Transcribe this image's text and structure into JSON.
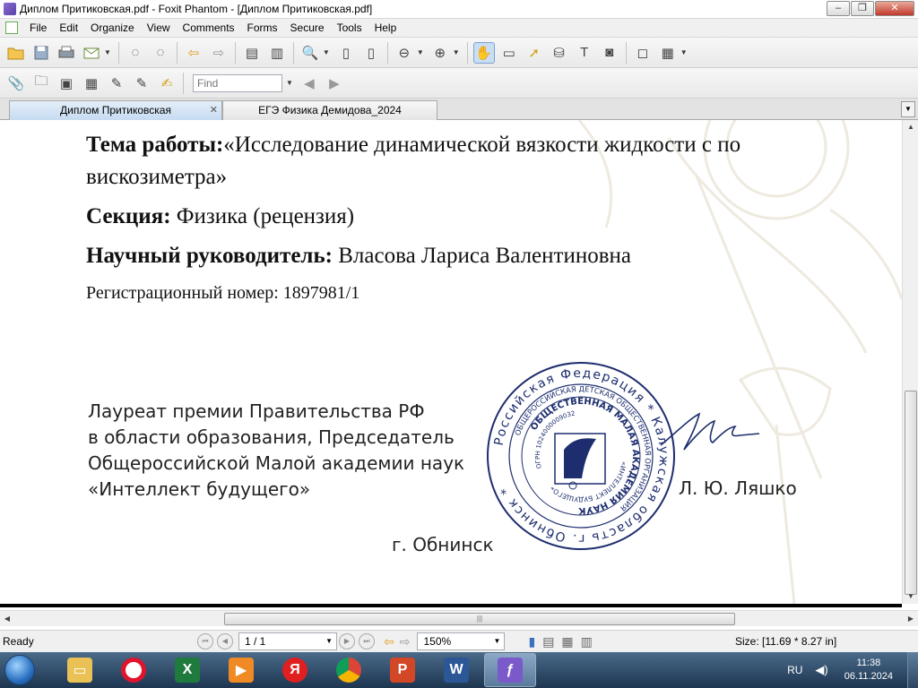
{
  "window": {
    "title": "Диплом Притиковская.pdf - Foxit Phantom - [Диплом Притиковская.pdf]",
    "buttons": [
      "–",
      "❐",
      "✕"
    ]
  },
  "menu": [
    "File",
    "Edit",
    "Organize",
    "View",
    "Comments",
    "Forms",
    "Secure",
    "Tools",
    "Help"
  ],
  "toolbar": {
    "find_placeholder": "Find"
  },
  "tabs": [
    {
      "label": "Диплом Притиковская",
      "active": true
    },
    {
      "label": "ЕГЭ Физика Демидова_2024",
      "active": false
    }
  ],
  "document": {
    "topic_label": "Тема работы:",
    "topic_value_line1": "«Исследование динамической вязкости жидкости с по",
    "topic_value_line2": "вискозиметра»",
    "section_label": "Секция:",
    "section_value": "Физика (рецензия)",
    "advisor_label": "Научный руководитель:",
    "advisor_value": "Власова Лариса Валентиновна",
    "registration": "Регистрационный номер: 1897981/1",
    "laureate_lines": [
      "Лауреат премии Правительства РФ",
      "в области образования, Председатель",
      "Общероссийской Малой академии наук",
      "«Интеллект будущего»"
    ],
    "signer": "Л. Ю. Ляшко",
    "city": "г. Обнинск",
    "stamp": {
      "outer_text": "Российская Федерация * Калужская область г. Обнинск *",
      "middle_text": "ОБЩЕРОССИЙСКАЯ ДЕТСКАЯ ОБЩЕСТВЕННАЯ ОРГАНИЗАЦИЯ",
      "inner_text": "ОБЩЕСТВЕННАЯ МАЛАЯ АКАДЕМИЯ НАУК",
      "core_text": "«ИНТЕЛЛЕКТ БУДУЩЕГО»",
      "ogrn": "ОГРН 1024000009032"
    }
  },
  "status": {
    "ready": "Ready",
    "page": "1 / 1",
    "zoom": "150%",
    "size": "Size: [11.69 * 8.27 in]"
  },
  "taskbar": {
    "lang": "RU",
    "time": "11:38",
    "date": "06.11.2024",
    "apps": [
      "explorer",
      "opera",
      "excel",
      "media-player",
      "yandex",
      "chrome",
      "powerpoint",
      "word",
      "foxit"
    ]
  },
  "colors": {
    "stamp_blue": "#1d2d6e",
    "tab_active": "#c6dbf1",
    "taskbar": "#1d3550"
  }
}
